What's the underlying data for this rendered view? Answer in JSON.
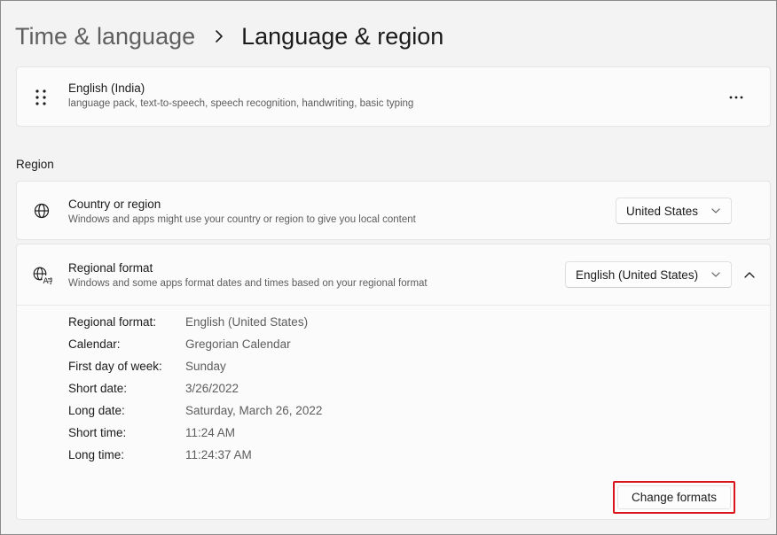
{
  "breadcrumb": {
    "parent": "Time & language",
    "current": "Language & region"
  },
  "language_card": {
    "name": "English (India)",
    "features": "language pack, text-to-speech, speech recognition, handwriting, basic typing",
    "drag_icon": "grip-dots-icon",
    "more_icon": "more-options-icon"
  },
  "region": {
    "heading": "Region",
    "country": {
      "title": "Country or region",
      "description": "Windows and apps might use your country or region to give you local content",
      "selected": "United States",
      "icon": "globe-icon"
    },
    "regional_format": {
      "title": "Regional format",
      "description": "Windows and some apps format dates and times based on your regional format",
      "selected": "English (United States)",
      "icon": "language-format-icon",
      "expanded": true,
      "details": [
        {
          "label": "Regional format:",
          "value": "English (United States)"
        },
        {
          "label": "Calendar:",
          "value": "Gregorian Calendar"
        },
        {
          "label": "First day of week:",
          "value": "Sunday"
        },
        {
          "label": "Short date:",
          "value": "3/26/2022"
        },
        {
          "label": "Long date:",
          "value": "Saturday, March 26, 2022"
        },
        {
          "label": "Short time:",
          "value": "11:24 AM"
        },
        {
          "label": "Long time:",
          "value": "11:24:37 AM"
        }
      ],
      "change_button": "Change formats"
    }
  },
  "colors": {
    "highlight": "#d9141c",
    "background": "#f3f3f3",
    "card": "#fbfbfb"
  }
}
